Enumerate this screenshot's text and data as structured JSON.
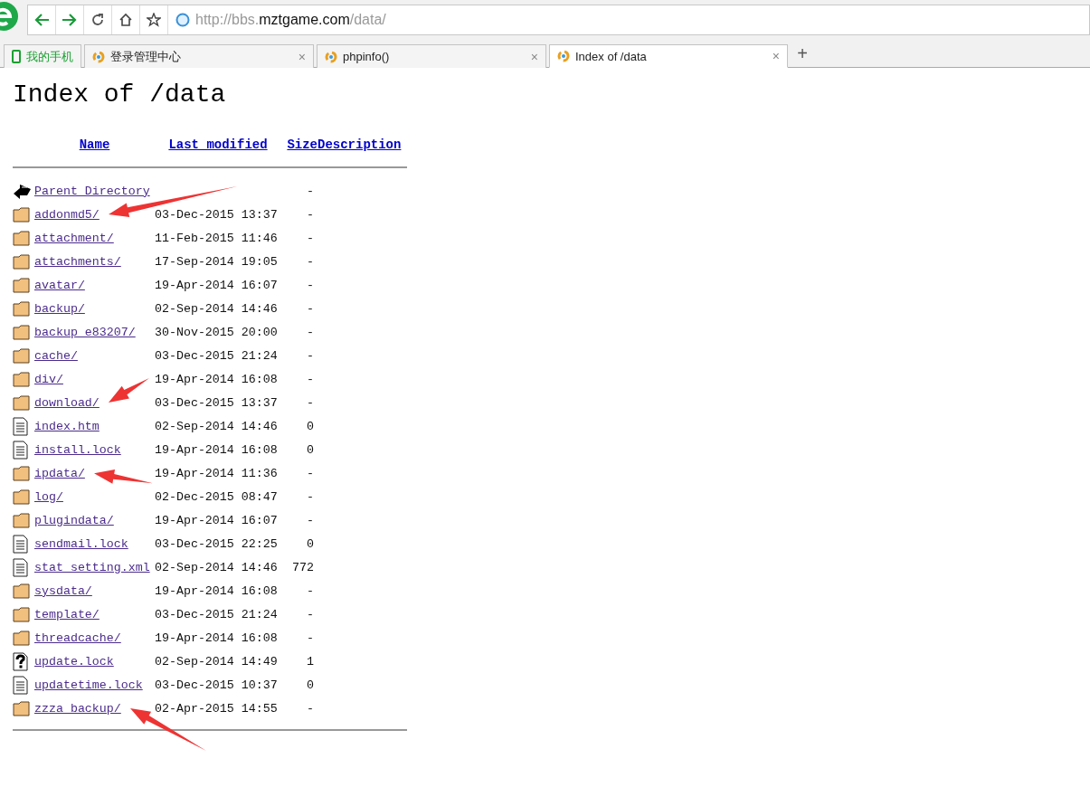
{
  "address_bar": {
    "scheme": "http://bbs.",
    "host": "mztgame.com",
    "path": "/data/"
  },
  "tabs": [
    {
      "label": "我的手机",
      "kind": "phone",
      "selected": false
    },
    {
      "label": "登录管理中心",
      "kind": "site",
      "selected": false,
      "close": "×"
    },
    {
      "label": "phpinfo()",
      "kind": "site",
      "selected": false,
      "close": "×"
    },
    {
      "label": "Index of /data",
      "kind": "site",
      "selected": true,
      "close": "×"
    }
  ],
  "new_tab": "+",
  "page": {
    "title": "Index of /data",
    "columns": [
      "Name",
      "Last modified",
      "Size",
      "Description"
    ],
    "rows": [
      {
        "kind": "parent",
        "name": "Parent Directory",
        "modified": "",
        "size": "-"
      },
      {
        "kind": "folder",
        "name": "addonmd5/",
        "modified": "03-Dec-2015 13:37",
        "size": "-",
        "arrow": {
          "kind": "up"
        }
      },
      {
        "kind": "folder",
        "name": "attachment/",
        "modified": "11-Feb-2015 11:46",
        "size": "-"
      },
      {
        "kind": "folder",
        "name": "attachments/",
        "modified": "17-Sep-2014 19:05",
        "size": "-"
      },
      {
        "kind": "folder",
        "name": "avatar/",
        "modified": "19-Apr-2014 16:07",
        "size": "-"
      },
      {
        "kind": "folder",
        "name": "backup/",
        "modified": "02-Sep-2014 14:46",
        "size": "-"
      },
      {
        "kind": "folder",
        "name": "backup_e83207/",
        "modified": "30-Nov-2015 20:00",
        "size": "-"
      },
      {
        "kind": "folder",
        "name": "cache/",
        "modified": "03-Dec-2015 21:24",
        "size": "-"
      },
      {
        "kind": "folder",
        "name": "div/",
        "modified": "19-Apr-2014 16:08",
        "size": "-"
      },
      {
        "kind": "folder",
        "name": "download/",
        "modified": "03-Dec-2015 13:37",
        "size": "-",
        "arrow": {
          "kind": "steep"
        }
      },
      {
        "kind": "text",
        "name": "index.htm",
        "modified": "02-Sep-2014 14:46",
        "size": "0"
      },
      {
        "kind": "text",
        "name": "install.lock",
        "modified": "19-Apr-2014 16:08",
        "size": "0"
      },
      {
        "kind": "folder",
        "name": "ipdata/",
        "modified": "19-Apr-2014 11:36",
        "size": "-",
        "arrow": {
          "kind": "right"
        }
      },
      {
        "kind": "folder",
        "name": "log/",
        "modified": "02-Dec-2015 08:47",
        "size": "-"
      },
      {
        "kind": "folder",
        "name": "plugindata/",
        "modified": "19-Apr-2014 16:07",
        "size": "-"
      },
      {
        "kind": "text",
        "name": "sendmail.lock",
        "modified": "03-Dec-2015 22:25",
        "size": "0"
      },
      {
        "kind": "text",
        "name": "stat_setting.xml",
        "modified": "02-Sep-2014 14:46",
        "size": "772"
      },
      {
        "kind": "folder",
        "name": "sysdata/",
        "modified": "19-Apr-2014 16:08",
        "size": "-"
      },
      {
        "kind": "folder",
        "name": "template/",
        "modified": "03-Dec-2015 21:24",
        "size": "-"
      },
      {
        "kind": "folder",
        "name": "threadcache/",
        "modified": "19-Apr-2014 16:08",
        "size": "-"
      },
      {
        "kind": "unknown",
        "name": "update.lock",
        "modified": "02-Sep-2014 14:49",
        "size": "1"
      },
      {
        "kind": "text",
        "name": "updatetime.lock",
        "modified": "03-Dec-2015 10:37",
        "size": "0"
      },
      {
        "kind": "folder",
        "name": "zzza_backup/",
        "modified": "02-Apr-2015 14:55",
        "size": "-",
        "arrow": {
          "kind": "down"
        }
      }
    ]
  }
}
